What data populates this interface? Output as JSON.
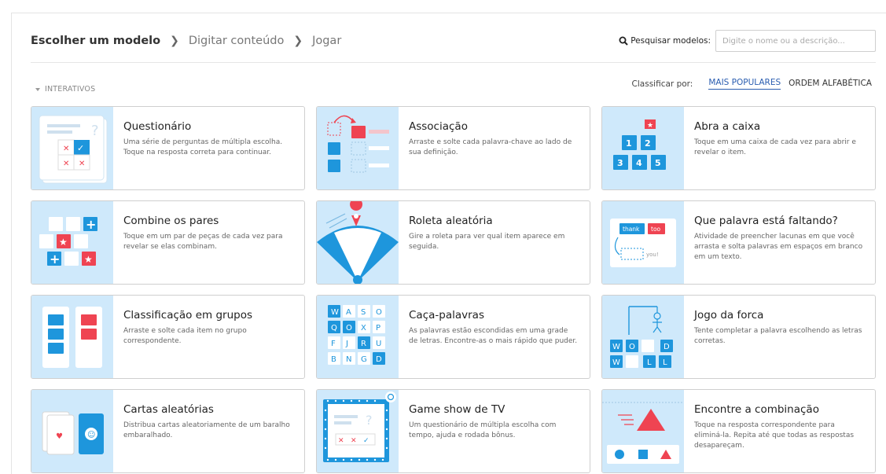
{
  "breadcrumb": {
    "step1": "Escolher um modelo",
    "step2": "Digitar conteúdo",
    "step3": "Jogar"
  },
  "search": {
    "label": "Pesquisar modelos:",
    "placeholder": "Digite o nome ou a descrição..."
  },
  "section": {
    "label": "INTERATIVOS"
  },
  "sort": {
    "label": "Classificar por:",
    "options": [
      "MAIS POPULARES",
      "ORDEM ALFABÉTICA"
    ],
    "active": "MAIS POPULARES"
  },
  "templates": [
    {
      "title": "Questionário",
      "description": "Uma série de perguntas de múltipla escolha. Toque na resposta correta para continuar.",
      "icon": "quiz-icon"
    },
    {
      "title": "Associação",
      "description": "Arraste e solte cada palavra-chave ao lado de sua definição.",
      "icon": "match-up-icon"
    },
    {
      "title": "Abra a caixa",
      "description": "Toque em uma caixa de cada vez para abrir e revelar o item.",
      "icon": "open-box-icon",
      "box_numbers": [
        "1",
        "2",
        "3",
        "4",
        "5"
      ]
    },
    {
      "title": "Combine os pares",
      "description": "Toque em um par de peças de cada vez para revelar se elas combinam.",
      "icon": "matching-pairs-icon"
    },
    {
      "title": "Roleta aleatória",
      "description": "Gire a roleta para ver qual item aparece em seguida.",
      "icon": "random-wheel-icon"
    },
    {
      "title": "Que palavra está faltando?",
      "description": "Atividade de preencher lacunas em que você arrasta e solta palavras em espaços em branco em um texto.",
      "icon": "missing-word-icon",
      "words": [
        "thank",
        "too",
        "you!"
      ]
    },
    {
      "title": "Classificação em grupos",
      "description": "Arraste e solte cada item no grupo correspondente.",
      "icon": "group-sort-icon"
    },
    {
      "title": "Caça-palavras",
      "description": "As palavras estão escondidas em uma grade de letras. Encontre-as o mais rápido que puder.",
      "icon": "wordsearch-icon",
      "letters": [
        "W",
        "A",
        "S",
        "O",
        "Q",
        "O",
        "X",
        "P",
        "F",
        "J",
        "R",
        "U",
        "B",
        "N",
        "G",
        "D"
      ]
    },
    {
      "title": "Jogo da forca",
      "description": "Tente completar a palavra escolhendo as letras corretas.",
      "icon": "hangman-icon",
      "letters": [
        "W",
        "O",
        "D",
        "W",
        "L",
        "L"
      ]
    },
    {
      "title": "Cartas aleatórias",
      "description": "Distribua cartas aleatoriamente de um baralho embaralhado.",
      "icon": "random-cards-icon"
    },
    {
      "title": "Game show de TV",
      "description": "Um questionário de múltipla escolha com tempo, ajuda e rodada bônus.",
      "icon": "gameshow-quiz-icon"
    },
    {
      "title": "Encontre a combinação",
      "description": "Toque na resposta correspondente para eliminá-la. Repita até que todas as respostas desapareçam.",
      "icon": "find-the-match-icon"
    }
  ],
  "colors": {
    "thumb_bg": "#cfe9fb",
    "accent_blue": "#1e96dc",
    "accent_red": "#ef4452",
    "link_blue": "#2a5db0"
  }
}
